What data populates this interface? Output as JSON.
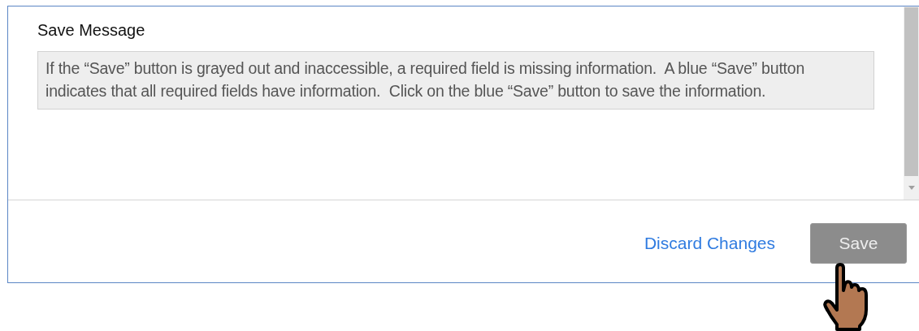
{
  "section": {
    "title": "Save Message",
    "message": "If the “Save” button is grayed out and inaccessible, a required field is missing information.  A blue “Save” button indicates that all required fields have information.  Click on the blue “Save” button to save the information."
  },
  "footer": {
    "link": "Discard Changes",
    "save_button": {
      "label": "Save",
      "disabled": true
    }
  }
}
